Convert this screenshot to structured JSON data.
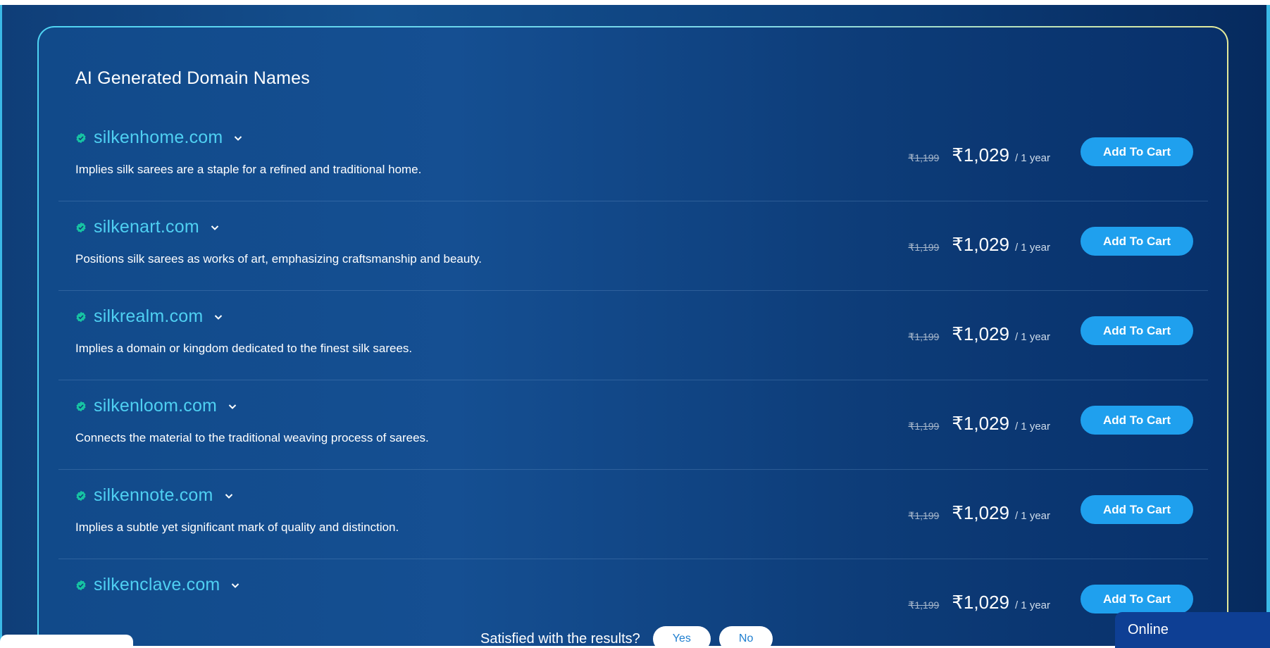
{
  "section": {
    "title": "AI Generated Domain Names"
  },
  "results": [
    {
      "domain": "silkenhome.com",
      "description": "Implies silk sarees are a staple for a refined and traditional home.",
      "old_price": "₹1,199",
      "price": "₹1,029",
      "period": "/ 1 year",
      "button": "Add To Cart"
    },
    {
      "domain": "silkenart.com",
      "description": "Positions silk sarees as works of art, emphasizing craftsmanship and beauty.",
      "old_price": "₹1,199",
      "price": "₹1,029",
      "period": "/ 1 year",
      "button": "Add To Cart"
    },
    {
      "domain": "silkrealm.com",
      "description": "Implies a domain or kingdom dedicated to the finest silk sarees.",
      "old_price": "₹1,199",
      "price": "₹1,029",
      "period": "/ 1 year",
      "button": "Add To Cart"
    },
    {
      "domain": "silkenloom.com",
      "description": "Connects the material to the traditional weaving process of sarees.",
      "old_price": "₹1,199",
      "price": "₹1,029",
      "period": "/ 1 year",
      "button": "Add To Cart"
    },
    {
      "domain": "silkennote.com",
      "description": "Implies a subtle yet significant mark of quality and distinction.",
      "old_price": "₹1,199",
      "price": "₹1,029",
      "period": "/ 1 year",
      "button": "Add To Cart"
    },
    {
      "domain": "silkenclave.com",
      "description": "",
      "old_price": "₹1,199",
      "price": "₹1,029",
      "period": "/ 1 year",
      "button": "Add To Cart"
    }
  ],
  "feedback": {
    "question": "Satisfied with the results?",
    "yes": "Yes",
    "no": "No"
  },
  "chat": {
    "status": "Online"
  },
  "icons": {
    "verified": "verified-badge-icon",
    "expand": "chevron-down-icon"
  },
  "colors": {
    "accent": "#4fd0f2",
    "button": "#1fa0ee",
    "verified": "#17c3a3",
    "background": "#114a8a"
  }
}
